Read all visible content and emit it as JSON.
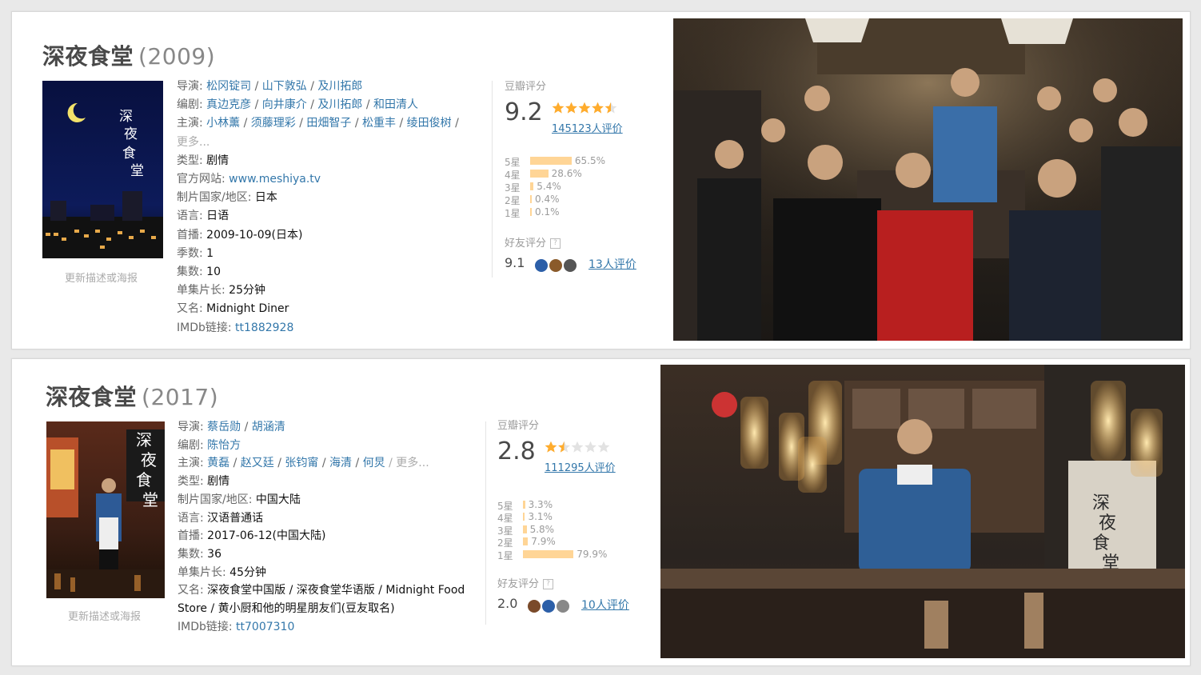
{
  "entries": [
    {
      "title": "深夜食堂",
      "year": "(2009)",
      "update_link": "更新描述或海报",
      "info": [
        {
          "key": "导演: ",
          "links": [
            "松冈锭司",
            "山下敦弘",
            "及川拓郎"
          ]
        },
        {
          "key": "编剧: ",
          "links": [
            "真边克彦",
            "向井康介",
            "及川拓郎",
            "和田清人"
          ]
        },
        {
          "key": "主演: ",
          "links": [
            "小林薰",
            "须藤理彩",
            "田畑智子",
            "松重丰",
            "绫田俊树"
          ],
          "trail": " /"
        },
        {
          "more": "更多..."
        },
        {
          "key": "类型: ",
          "value": "剧情"
        },
        {
          "key": "官方网站: ",
          "links": [
            "www.meshiya.tv"
          ]
        },
        {
          "key": "制片国家/地区: ",
          "value": "日本"
        },
        {
          "key": "语言: ",
          "value": "日语"
        },
        {
          "key": "首播: ",
          "value": "2009-10-09(日本)"
        },
        {
          "key": "季数: ",
          "value": "1"
        },
        {
          "key": "集数: ",
          "value": "10"
        },
        {
          "key": "单集片长: ",
          "value": "25分钟"
        },
        {
          "key": "又名: ",
          "value": "Midnight Diner"
        },
        {
          "key": "IMDb链接: ",
          "links": [
            "tt1882928"
          ]
        }
      ],
      "rating": {
        "label": "豆瓣评分",
        "score": "9.2",
        "stars": 4.5,
        "count": "145123人评价",
        "bars": [
          {
            "star": "5星",
            "pct": 65.5,
            "text": "65.5%"
          },
          {
            "star": "4星",
            "pct": 28.6,
            "text": "28.6%"
          },
          {
            "star": "3星",
            "pct": 5.4,
            "text": "5.4%"
          },
          {
            "star": "2星",
            "pct": 0.4,
            "text": "0.4%"
          },
          {
            "star": "1星",
            "pct": 0.1,
            "text": "0.1%"
          }
        ],
        "friend_label": "好友评分",
        "friend_qmark": "?",
        "friend_score": "9.1",
        "friend_count": "13人评价"
      }
    },
    {
      "title": "深夜食堂",
      "year": "(2017)",
      "update_link": "更新描述或海报",
      "info": [
        {
          "key": "导演: ",
          "links": [
            "蔡岳勋",
            "胡涵清"
          ]
        },
        {
          "key": "编剧: ",
          "links": [
            "陈怡方"
          ]
        },
        {
          "key": "主演: ",
          "links": [
            "黄磊",
            "赵又廷",
            "张钧甯",
            "海清",
            "何炅"
          ],
          "more": " / 更多..."
        },
        {
          "key": "类型: ",
          "value": "剧情"
        },
        {
          "key": "制片国家/地区: ",
          "value": "中国大陆"
        },
        {
          "key": "语言: ",
          "value": "汉语普通话"
        },
        {
          "key": "首播: ",
          "value": "2017-06-12(中国大陆)"
        },
        {
          "key": "集数: ",
          "value": "36"
        },
        {
          "key": "单集片长: ",
          "value": "45分钟"
        },
        {
          "key": "又名: ",
          "value": "深夜食堂中国版 / 深夜食堂华语版 / Midnight Food"
        },
        {
          "value": "Store / 黄小厨和他的明星朋友们(豆友取名)"
        },
        {
          "key": "IMDb链接: ",
          "links": [
            "tt7007310"
          ]
        }
      ],
      "rating": {
        "label": "豆瓣评分",
        "score": "2.8",
        "stars": 1.5,
        "count": "111295人评价",
        "bars": [
          {
            "star": "5星",
            "pct": 3.3,
            "text": "3.3%"
          },
          {
            "star": "4星",
            "pct": 3.1,
            "text": "3.1%"
          },
          {
            "star": "3星",
            "pct": 5.8,
            "text": "5.8%"
          },
          {
            "star": "2星",
            "pct": 7.9,
            "text": "7.9%"
          },
          {
            "star": "1星",
            "pct": 79.9,
            "text": "79.9%"
          }
        ],
        "friend_label": "好友评分",
        "friend_qmark": "?",
        "friend_score": "2.0",
        "friend_count": "10人评价"
      }
    }
  ],
  "colors": {
    "link": "#3377aa",
    "star": "#ffac2d",
    "bar": "#ffd596"
  }
}
